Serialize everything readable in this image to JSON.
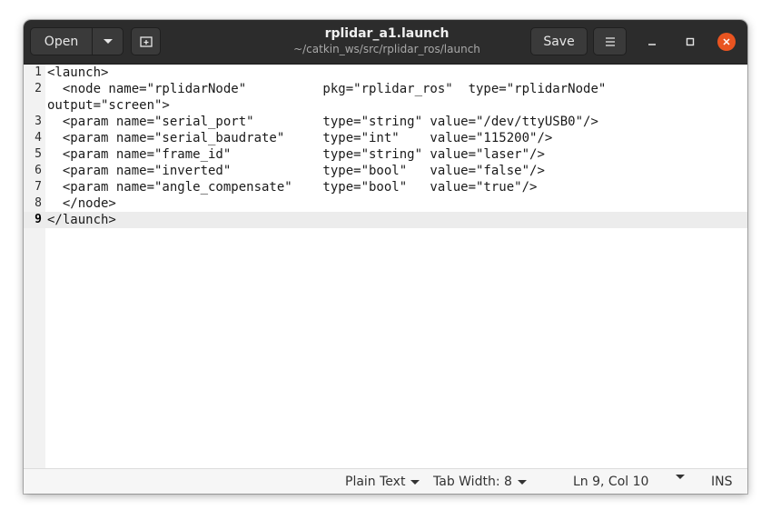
{
  "window": {
    "title": "rplidar_a1.launch",
    "subtitle": "~/catkin_ws/src/rplidar_ros/launch"
  },
  "toolbar": {
    "open_label": "Open",
    "save_label": "Save",
    "open_dropdown_icon": "chevron-down-icon",
    "new_tab_icon": "new-document-icon",
    "menu_icon": "hamburger-menu-icon"
  },
  "window_controls": {
    "minimize_icon": "minimize-icon",
    "maximize_icon": "maximize-icon",
    "close_icon": "close-icon",
    "close_color": "#e95420"
  },
  "editor": {
    "lines": [
      {
        "number": "1",
        "text": "<launch>"
      },
      {
        "number": "2",
        "text": "  <node name=\"rplidarNode\"          pkg=\"rplidar_ros\"  type=\"rplidarNode\""
      },
      {
        "number": "",
        "text": "output=\"screen\">"
      },
      {
        "number": "3",
        "text": "  <param name=\"serial_port\"         type=\"string\" value=\"/dev/ttyUSB0\"/>"
      },
      {
        "number": "4",
        "text": "  <param name=\"serial_baudrate\"     type=\"int\"    value=\"115200\"/>"
      },
      {
        "number": "5",
        "text": "  <param name=\"frame_id\"            type=\"string\" value=\"laser\"/>"
      },
      {
        "number": "6",
        "text": "  <param name=\"inverted\"            type=\"bool\"   value=\"false\"/>"
      },
      {
        "number": "7",
        "text": "  <param name=\"angle_compensate\"    type=\"bool\"   value=\"true\"/>"
      },
      {
        "number": "8",
        "text": "  </node>"
      },
      {
        "number": "9",
        "text": "</launch>"
      }
    ],
    "current_line": "9"
  },
  "statusbar": {
    "language": "Plain Text",
    "tab_width": "Tab Width: 8",
    "position": "Ln 9, Col 10",
    "mode": "INS"
  }
}
